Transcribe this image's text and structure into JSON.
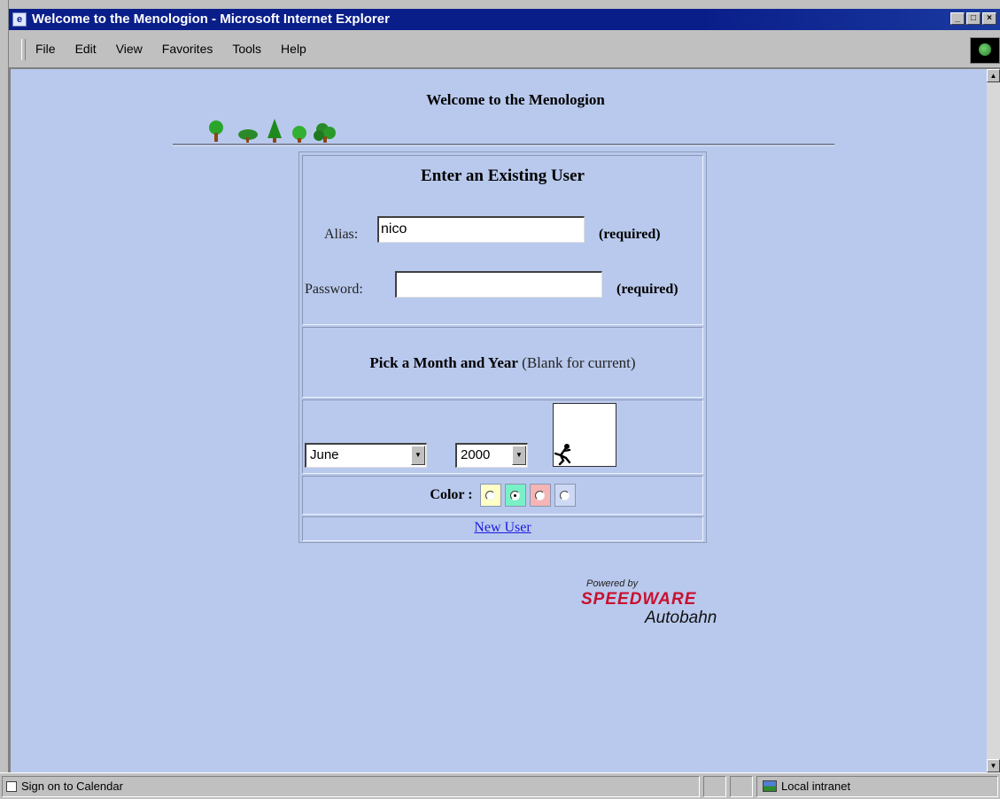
{
  "window": {
    "title": "Welcome to the Menologion - Microsoft Internet Explorer",
    "controls": [
      "minimize",
      "maximize",
      "close"
    ]
  },
  "menu": {
    "items": [
      "File",
      "Edit",
      "View",
      "Favorites",
      "Tools",
      "Help"
    ]
  },
  "page": {
    "title": "Welcome to the Menologion"
  },
  "login": {
    "heading": "Enter an Existing User",
    "alias_label": "Alias:",
    "alias_value": "nico",
    "alias_required": "(required)",
    "password_label": "Password:",
    "password_value": "",
    "password_required": "(required)"
  },
  "date_pick": {
    "heading": "Pick a Month and Year",
    "hint": "(Blank for current)",
    "month": "June",
    "year": "2000"
  },
  "colors": {
    "label": "Color :",
    "options": [
      {
        "color": "#ffffc6",
        "selected": false
      },
      {
        "color": "#79f0c7",
        "selected": true
      },
      {
        "color": "#f5b5b5",
        "selected": false
      },
      {
        "color": "#cdd8f5",
        "selected": false
      }
    ]
  },
  "links": {
    "new_user": "New User"
  },
  "logo": {
    "powered_by": "Powered by",
    "brand_1": "SPEEDWARE",
    "brand_2": "Autobahn"
  },
  "status": {
    "text": "Sign on to Calendar",
    "zone": "Local intranet"
  },
  "theme": {
    "page_background": "#b9c9ed",
    "titlebar": "#0a1e8a",
    "link": "#1a1ae0",
    "logo_red": "#c8102e"
  }
}
